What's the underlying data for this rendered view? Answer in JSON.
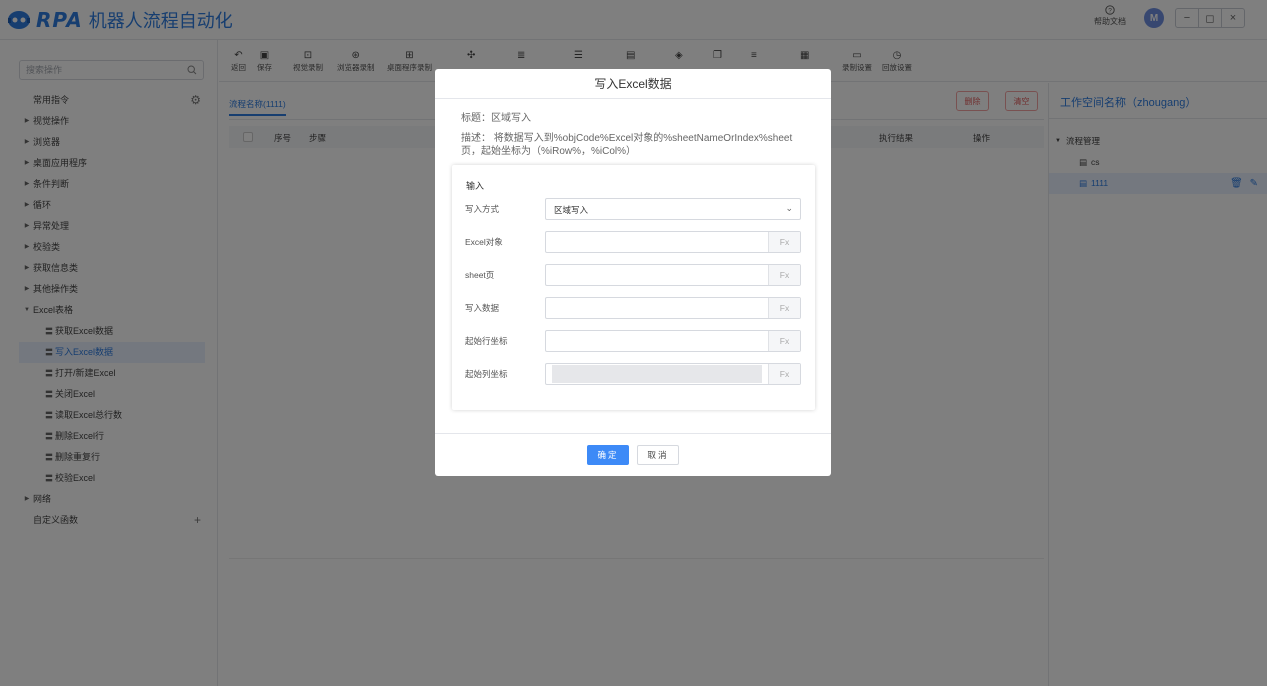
{
  "header": {
    "logo_rpa": "RPA",
    "app_name": "机器人流程自动化",
    "help_label": "帮助文档",
    "avatar_initial": "M",
    "window_controls": [
      "−",
      "◻",
      "×"
    ]
  },
  "sidebar": {
    "search_placeholder": "搜索操作",
    "common_label": "常用指令",
    "categories": [
      "视觉操作",
      "浏览器",
      "桌面应用程序",
      "条件判断",
      "循环",
      "异常处理",
      "校验类",
      "获取信息类",
      "其他操作类"
    ],
    "excel_label": "Excel表格",
    "excel_children": [
      "获取Excel数据",
      "写入Excel数据",
      "打开/新建Excel",
      "关闭Excel",
      "读取Excel总行数",
      "删除Excel行",
      "删除重复行",
      "校验Excel"
    ],
    "network_label": "网络",
    "custom_label": "自定义函数"
  },
  "toolbar": {
    "items": [
      "返回",
      "保存",
      "视觉录制",
      "浏览器录制",
      "桌面程序录制",
      "",
      "",
      "",
      "",
      "",
      "",
      "",
      "",
      "",
      "录制设置",
      "回放设置"
    ]
  },
  "main": {
    "flow_tab": "流程名称(1111)",
    "delete_label": "删除",
    "clear_label": "清空",
    "columns": {
      "index": "序号",
      "step": "步骤",
      "result": "执行结果",
      "action": "操作"
    }
  },
  "right_panel": {
    "workspace_title": "工作空间名称（zhougang）",
    "root_label": "流程管理",
    "files": [
      "cs",
      "1111"
    ]
  },
  "modal": {
    "title": "写入Excel数据",
    "subtitle": "标题：区域写入",
    "desc_line1": "描述： 将数据写入到%objCode%Excel对象的%sheetNameOrIndex%sheet",
    "desc_line2": "页，起始坐标为（%iRow%，%iCol%）",
    "section_label": "输入",
    "fields": [
      {
        "label": "写入方式",
        "value": "区域写入"
      },
      {
        "label": "Excel对象",
        "value": ""
      },
      {
        "label": "sheet页",
        "value": ""
      },
      {
        "label": "写入数据",
        "value": ""
      },
      {
        "label": "起始行坐标",
        "value": ""
      },
      {
        "label": "起始列坐标",
        "value": ""
      }
    ],
    "fx_label": "Fx",
    "ok_label": "确定",
    "cancel_label": "取消"
  },
  "colors": {
    "accent": "#2e7de1",
    "danger": "#e05b5b",
    "primary_button": "#3d8af7"
  }
}
